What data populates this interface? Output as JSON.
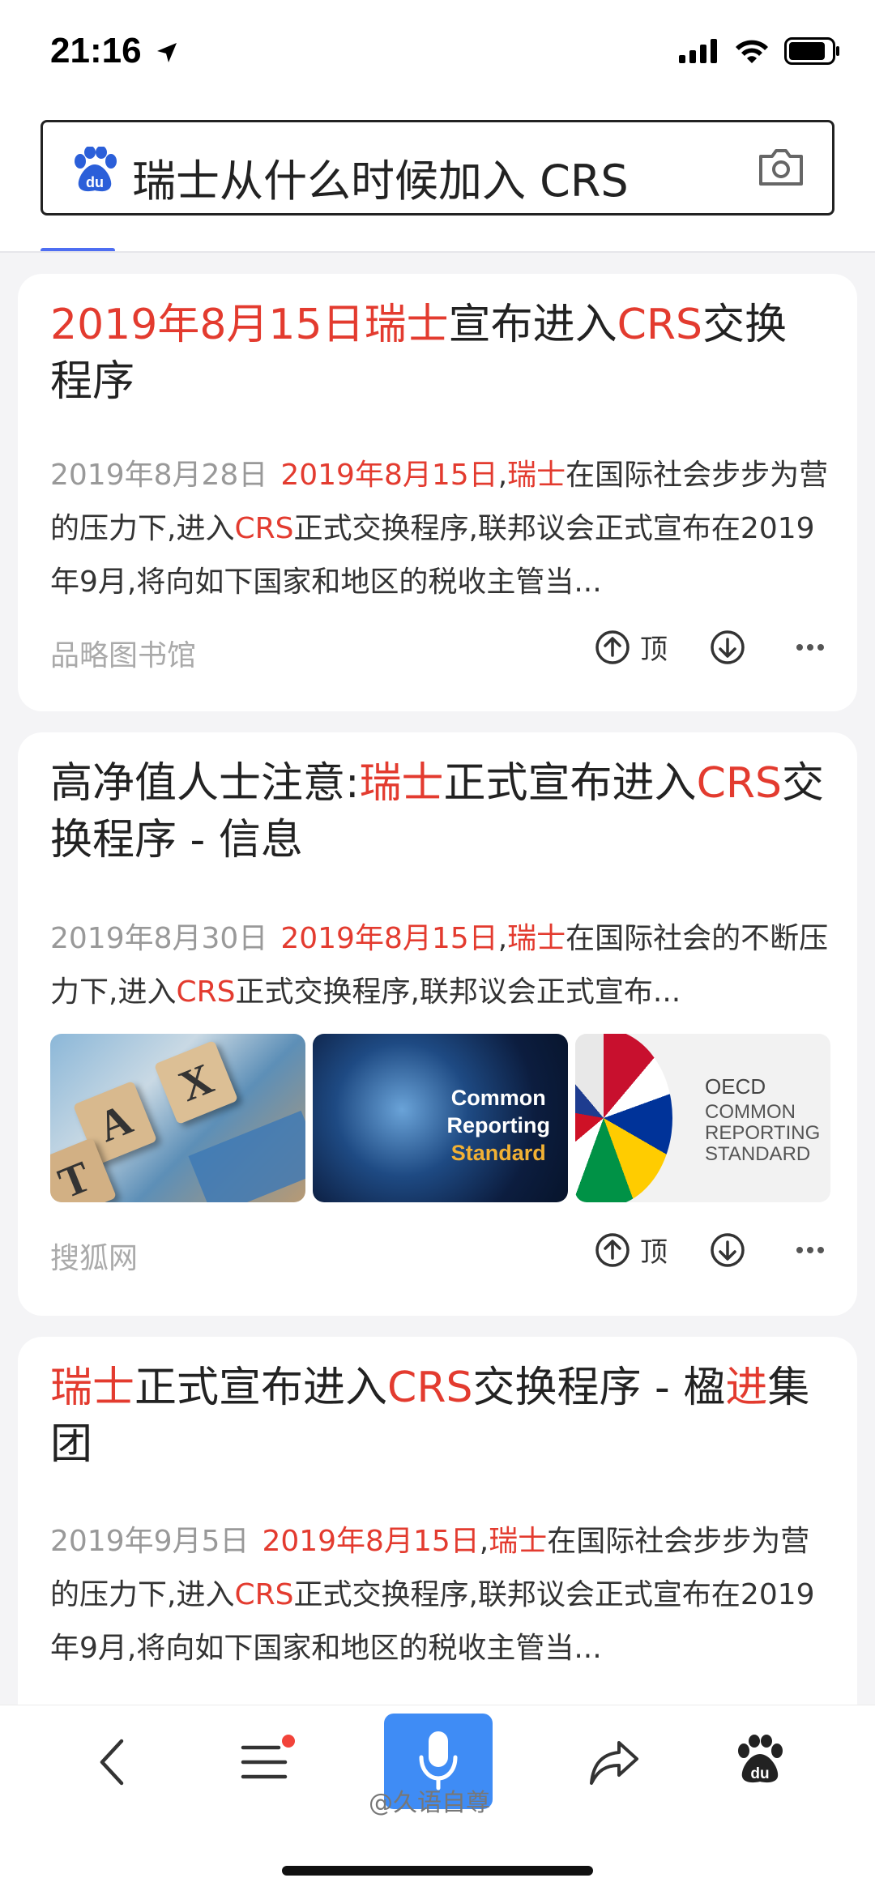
{
  "status": {
    "time": "21:16"
  },
  "search": {
    "query": "瑞士从什么时候加入 CRS"
  },
  "results": [
    {
      "title": [
        {
          "t": "2019年8月15日瑞士",
          "hl": true
        },
        {
          "t": "宣布进入",
          "hl": false
        },
        {
          "t": "CRS",
          "hl": true
        },
        {
          "t": "交换程序",
          "hl": false
        }
      ],
      "date": "2019年8月28日",
      "summary": [
        {
          "t": "2019年8月15日",
          "hl": true
        },
        {
          "t": ",",
          "hl": false
        },
        {
          "t": "瑞士",
          "hl": true
        },
        {
          "t": "在国际社会步步为营的压力下,进入",
          "hl": false
        },
        {
          "t": "CRS",
          "hl": true
        },
        {
          "t": "正式交换程序,联邦议会正式宣布在2019年9月,将向如下国家和地区的税收主管当...",
          "hl": false
        }
      ],
      "source": "品略图书馆",
      "up_label": "顶"
    },
    {
      "title": [
        {
          "t": "高净值人士注意:",
          "hl": false
        },
        {
          "t": "瑞士",
          "hl": true
        },
        {
          "t": "正式宣布进入",
          "hl": false
        },
        {
          "t": "CRS",
          "hl": true
        },
        {
          "t": "交换程序 - 信息",
          "hl": false
        }
      ],
      "date": "2019年8月30日",
      "summary": [
        {
          "t": "2019年8月15日",
          "hl": true
        },
        {
          "t": ",",
          "hl": false
        },
        {
          "t": "瑞士",
          "hl": true
        },
        {
          "t": "在国际社会的不断压力下,进入",
          "hl": false
        },
        {
          "t": "CRS",
          "hl": true
        },
        {
          "t": "正式交换程序,联邦议会正式宣布...",
          "hl": false
        }
      ],
      "images": [
        {
          "name": "tax-tiles-image",
          "text": ""
        },
        {
          "name": "crs-globe-image",
          "lines": [
            "Common",
            "Reporting",
            "Standard"
          ]
        },
        {
          "name": "oecd-flags-image",
          "lines": [
            "OECD",
            "COMMON",
            "REPORTING",
            "STANDARD"
          ]
        }
      ],
      "source": "搜狐网",
      "up_label": "顶"
    },
    {
      "title": [
        {
          "t": "瑞士",
          "hl": true
        },
        {
          "t": "正式宣布进入",
          "hl": false
        },
        {
          "t": "CRS",
          "hl": true
        },
        {
          "t": "交换程序 - 楹",
          "hl": false
        },
        {
          "t": "进",
          "hl": true
        },
        {
          "t": "集团",
          "hl": false
        }
      ],
      "date": "2019年9月5日",
      "summary": [
        {
          "t": "2019年8月15日",
          "hl": true
        },
        {
          "t": ",",
          "hl": false
        },
        {
          "t": "瑞士",
          "hl": true
        },
        {
          "t": "在国际社会步步为营的压力下,进入",
          "hl": false
        },
        {
          "t": "CRS",
          "hl": true
        },
        {
          "t": "正式交换程序,联邦议会正式宣布在2019年9月,将向如下国家和地区的税收主管当...",
          "hl": false
        }
      ]
    }
  ],
  "watermark": "@久语自尊",
  "colors": {
    "highlight": "#e33b2f",
    "accent": "#3f8cf5",
    "tab_indicator": "#4e6ef2"
  }
}
